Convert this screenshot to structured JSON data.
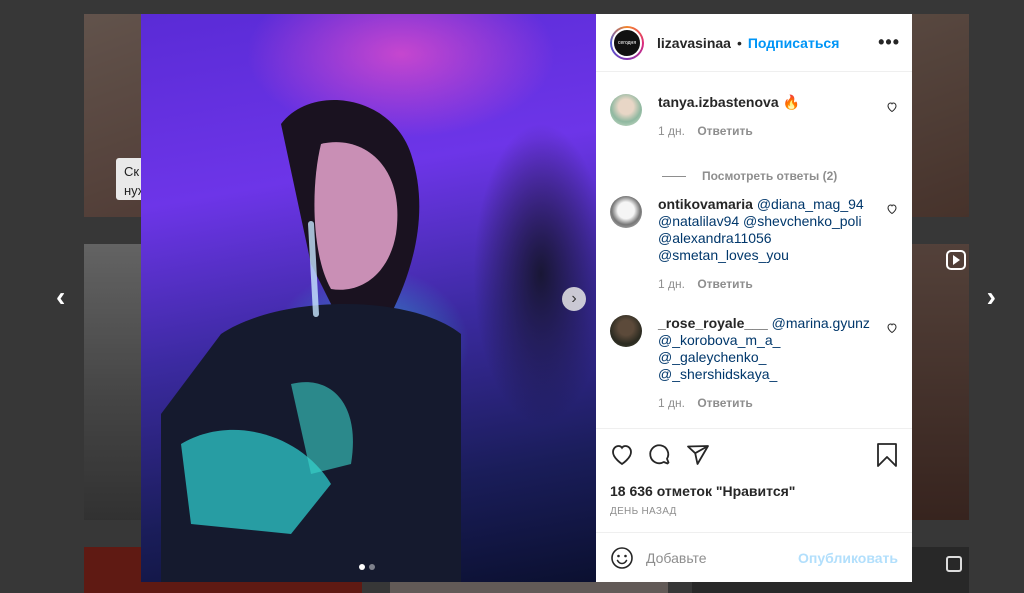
{
  "background": {
    "label_text": "Ск нуж"
  },
  "post": {
    "username": "lizavasinaa",
    "avatar_text": "сегодня",
    "separator": "•",
    "follow_label": "Подписаться",
    "more_label": "•••",
    "next_label": "›",
    "likes": "18 636 отметок \"Нравится\"",
    "date": "ДЕНЬ НАЗАД"
  },
  "nav": {
    "prev": "‹",
    "next": "›"
  },
  "comments": [
    {
      "user": "tanya.izbastenova",
      "text": "🔥",
      "time": "1 дн.",
      "reply": "Ответить",
      "view_replies": "Посмотреть ответы (2)"
    },
    {
      "user": "ontikovamaria",
      "mentions": [
        "@diana_mag_94",
        "@natalilav94",
        "@shevchenko_poli",
        "@alexandra11056",
        "@smetan_loves_you"
      ],
      "time": "1 дн.",
      "reply": "Ответить"
    },
    {
      "user": "_rose_royale___",
      "mentions": [
        "@marina.gyunz",
        "@_korobova_m_a_",
        "@_galeychenko_",
        "@_shershidskaya_"
      ],
      "time": "1 дн.",
      "reply": "Ответить"
    }
  ],
  "add_comment": {
    "placeholder": "Добавьте",
    "publish_label": "Опубликовать"
  },
  "colors": {
    "accent": "#0095f6",
    "mention": "#00376b",
    "publish_disabled": "#b2dffc"
  }
}
